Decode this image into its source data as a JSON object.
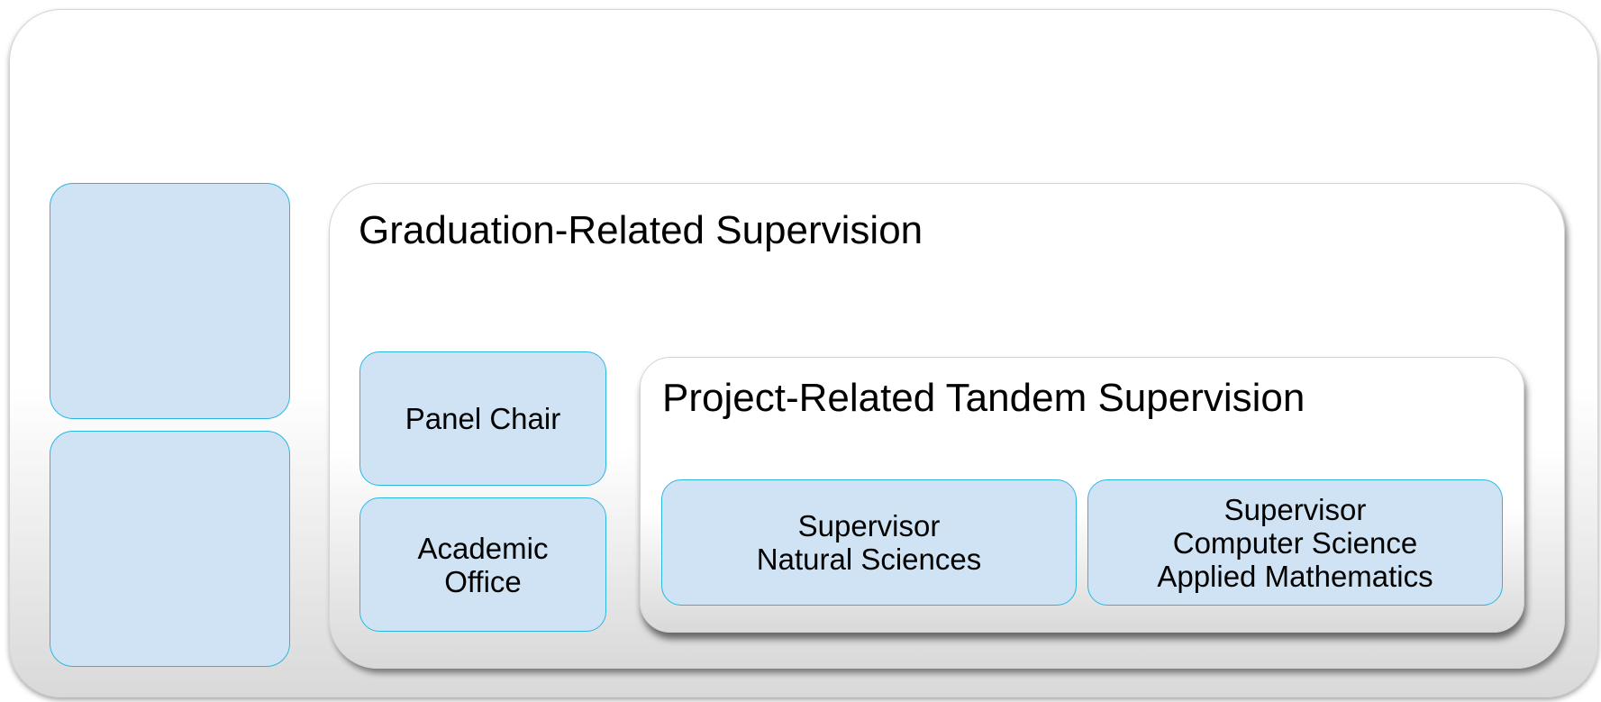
{
  "outer_panel": {},
  "graduation_panel": {
    "title": "Graduation-Related Supervision",
    "boxes": [
      {
        "label": "Panel Chair"
      },
      {
        "label": "Academic\nOffice"
      }
    ]
  },
  "tandem_panel": {
    "title": "Project-Related Tandem Supervision",
    "boxes": [
      {
        "label": "Supervisor\nNatural Sciences"
      },
      {
        "label": "Supervisor\nComputer Science\nApplied Mathematics"
      }
    ]
  },
  "left_boxes": [
    {
      "label": ""
    },
    {
      "label": ""
    }
  ],
  "colors": {
    "box_fill": "#cfe3f4",
    "box_border": "#2bb6e0",
    "panel_fill_top": "#ffffff",
    "panel_fill_bottom": "#d9d9d9"
  }
}
